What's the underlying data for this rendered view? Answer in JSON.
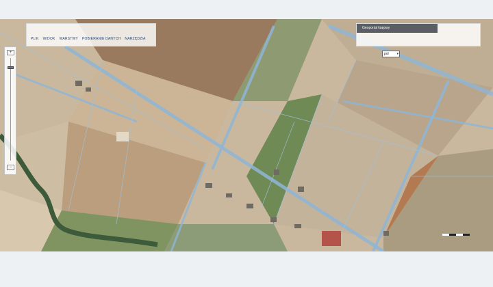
{
  "toolbar": {
    "items": [
      "PLIK",
      "WIDOK",
      "WARSTWY",
      "POBIERANIE DANYCH",
      "NARZĘDZIA"
    ]
  },
  "panel": {
    "title": "Geoportal krajowy"
  },
  "layer_select": {
    "value": "pol"
  },
  "zoom": {
    "in_symbol": "+",
    "out_symbol": "−",
    "level_fraction": 0.08
  },
  "colors": {
    "panel_title_bg": "#5b5f63",
    "menu_text": "#254a7a",
    "parcel_lines": "#8fb6d6"
  }
}
